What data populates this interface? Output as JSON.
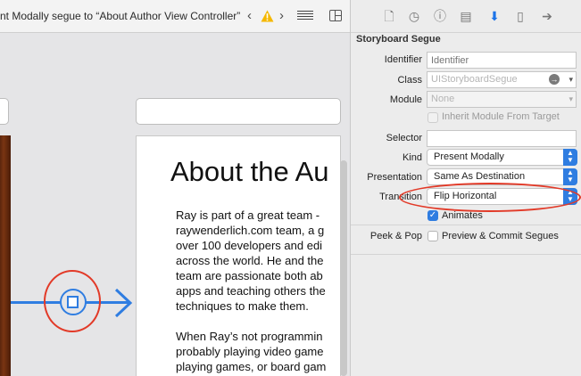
{
  "breadcrumb": "nt Modally segue to “About Author View Controller”",
  "icons": {
    "back": "chevron-left-icon",
    "forward": "chevron-right-icon",
    "warning": "warning-icon",
    "editor_options": "lines-icon",
    "inspector_toggle": "inspector-toggle-icon"
  },
  "colors": {
    "accent": "#2f7de1",
    "annotation": "#e23a28",
    "warning": "#f5b800"
  },
  "scene": {
    "title": "About the Au",
    "body": "Ray is part of a great team -\nraywenderlich.com team, a g\nover 100 developers and edi\nacross the world. He and the\nteam are passionate both ab\napps and teaching others the\ntechniques to make them.\n\nWhen Ray’s not programmin\nprobably playing video game\nplaying games, or board gam"
  },
  "inspector": {
    "tabs": [
      "file-icon",
      "history-icon",
      "help-icon",
      "identity-icon",
      "attributes-icon",
      "size-icon",
      "connections-icon"
    ],
    "section_title": "Storyboard Segue",
    "identifier": {
      "label": "Identifier",
      "value": "",
      "placeholder": "Identifier"
    },
    "class": {
      "label": "Class",
      "value": "UIStoryboardSegue"
    },
    "module": {
      "label": "Module",
      "value": "None"
    },
    "inherit": {
      "label": "Inherit Module From Target",
      "checked": false
    },
    "selector": {
      "label": "Selector",
      "value": ""
    },
    "kind": {
      "label": "Kind",
      "value": "Present Modally"
    },
    "presentation": {
      "label": "Presentation",
      "value": "Same As Destination"
    },
    "transition": {
      "label": "Transition",
      "value": "Flip Horizontal"
    },
    "animates": {
      "label": "Animates",
      "checked": true
    },
    "peek": {
      "label": "Peek & Pop",
      "option": "Preview & Commit Segues",
      "checked": false
    }
  }
}
